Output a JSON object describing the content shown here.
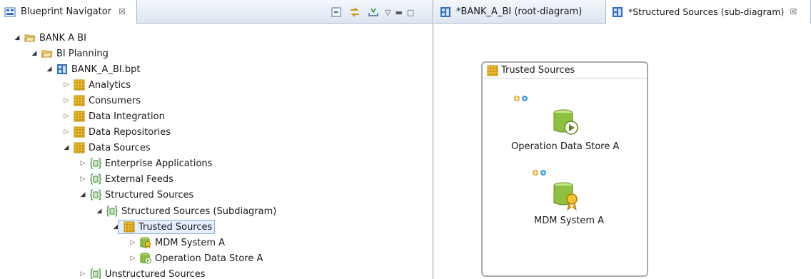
{
  "left": {
    "view_title": "Blueprint Navigator",
    "close_glyph": "☒",
    "tree": [
      {
        "label": "BANK A BI",
        "icon": "folder-open-icon"
      },
      {
        "label": "BI Planning",
        "icon": "folder-open-icon"
      },
      {
        "label": "BANK_A_BI.bpt",
        "icon": "blueprint-file-icon"
      },
      {
        "label": "Analytics",
        "icon": "grid-icon"
      },
      {
        "label": "Consumers",
        "icon": "grid-icon"
      },
      {
        "label": "Data Integration",
        "icon": "grid-icon"
      },
      {
        "label": "Data Repositories",
        "icon": "grid-icon"
      },
      {
        "label": "Data Sources",
        "icon": "grid-icon"
      },
      {
        "label": "Enterprise Applications",
        "icon": "component-icon"
      },
      {
        "label": "External Feeds",
        "icon": "component-icon"
      },
      {
        "label": "Structured Sources",
        "icon": "component-icon"
      },
      {
        "label": "Structured Sources (Subdiagram)",
        "icon": "component-icon"
      },
      {
        "label": "Trusted Sources",
        "icon": "grid-icon"
      },
      {
        "label": "MDM System A",
        "icon": "mdm-icon"
      },
      {
        "label": "Operation Data Store A",
        "icon": "datastore-icon"
      },
      {
        "label": "Unstructured Sources",
        "icon": "component-icon"
      }
    ]
  },
  "editor": {
    "tabs": [
      {
        "label": "*BANK_A_BI (root-diagram)"
      },
      {
        "label": "*Structured Sources (sub-diagram)",
        "close": "☒"
      }
    ],
    "group_title": "Trusted Sources",
    "nodes": [
      {
        "label": "Operation Data Store A"
      },
      {
        "label": "MDM System A"
      }
    ]
  },
  "colors": {
    "grid": "#e0a800",
    "folder": "#e8c56a",
    "blueprint": "#2f6fbf",
    "node_green": "#8fc140"
  }
}
